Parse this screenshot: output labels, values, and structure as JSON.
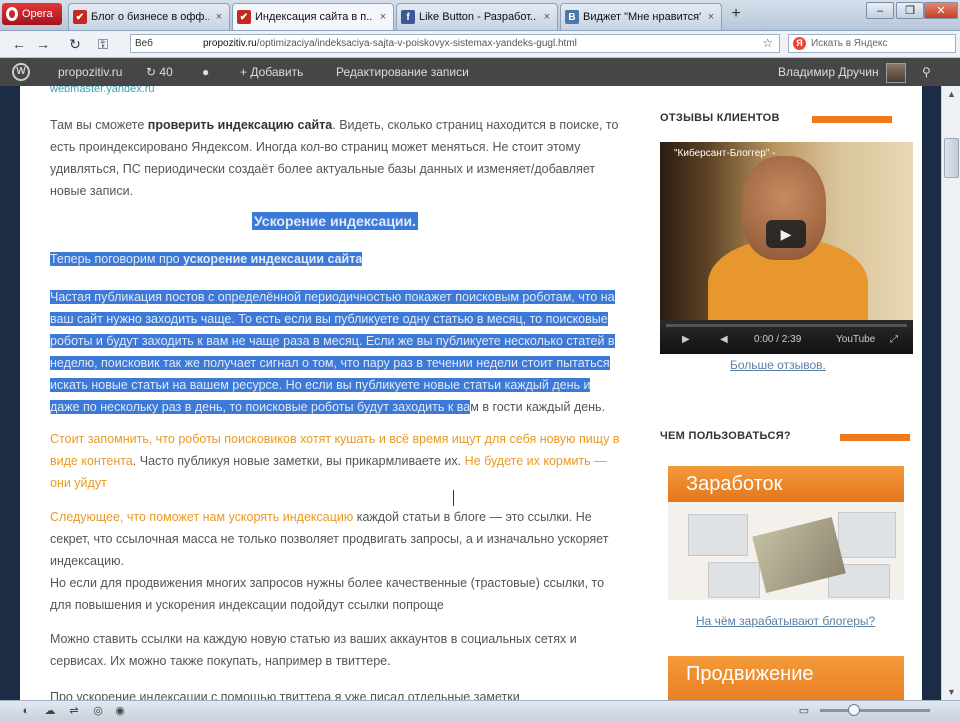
{
  "browser": {
    "app_label": "Opera",
    "tabs": [
      {
        "title": "Блог о бизнесе в офф...",
        "favicon": "blogger-icon",
        "active": false
      },
      {
        "title": "Индексация сайта в п...",
        "favicon": "blogger-icon",
        "active": true
      },
      {
        "title": "Like Button - Разработ...",
        "favicon": "facebook-icon",
        "active": false
      },
      {
        "title": "Виджет \"Мне нравится\"",
        "favicon": "vk-icon",
        "active": false
      }
    ],
    "new_tab": "+",
    "web_label": "Веб",
    "url_domain": "propozitiv.ru",
    "url_path": "/optimizaciya/indeksaciya-sajta-v-poiskovyx-sistemax-yandeks-gugl.html",
    "search_placeholder": "Искать в Яндекс"
  },
  "wpbar": {
    "site": "propozitiv.ru",
    "updates": "40",
    "add": "+ Добавить",
    "edit": "Редактирование записи",
    "user": "Владимир Дручин"
  },
  "content": {
    "top_link": "webmaster.yandex.ru",
    "p1_a": "Там вы сможете ",
    "p1_b": "проверить индексацию сайта",
    "p1_c": ". Видеть, сколько страниц находится в поиске, то есть проиндексировано Яндексом. Иногда кол-во страниц может меняться. Не стоит этому удивляться, ПС периодически создаёт более актуальные базы данных и изменяет/добавляет новые записи.",
    "heading": "Ускорение индексации.",
    "p2_a": "Теперь поговорим про ",
    "p2_b": "ускорение индексации сайта",
    "p3_sel": "Частая публикация постов с определённой периодичностью покажет поисковым роботам, что на ваш сайт нужно заходить чаще. То есть если вы публикуете одну статью в месяц, то поисковые роботы и будут заходить к вам не чаще раза в месяц. Если же вы публикуете несколько статей в неделю, поисковик так же получает сигнал о том, что пару раз в течении недели стоит пытаться искать новые статьи на вашем ресурсе. Но если вы публикуете новые статьи каждый день и даже по нескольку раз в день, то поисковые роботы будут заходить к ва",
    "p3_rest": "м в гости каждый день.",
    "p4_a": "Стоит запомнить, что роботы поисковиков хотят кушать и всё время ищут для себя новую пищу в виде контента",
    "p4_b": ". Часто публикуя новые заметки, вы прикармливаете их. ",
    "p4_c": "Не будете их кормить — они уйдут",
    "p5_a": "Следующее, что поможет нам ускорять индексацию",
    "p5_b": " каждой статьи в блоге — это ссылки. Не секрет, что ссылочная масса не только позволяет продвигать запросы, а и изначально ускоряет индексацию.",
    "p5_c": "Но если для продвижения многих запросов нужны более качественные (трастовые) ссылки, то для повышения и ускорения индексации подойдут ссылки попроще",
    "p6": "Можно ставить ссылки на каждую новую статью из ваших аккаунтов в социальных сетях и сервисах. Их можно также покупать, например в твиттере.",
    "p7": "Про ускорение индексации с помощью твиттера я уже писал отдельные заметки"
  },
  "sidebar": {
    "reviews_title": "ОТЗЫВЫ КЛИЕНТОВ",
    "video_title": "\"Киберсант-Блоггер\" -",
    "video_time": "0:00 / 2:39",
    "video_brand": "YouTube",
    "more_reviews": "Больше отзывов.",
    "tools_title": "ЧЕМ ПОЛЬЗОВАТЬСЯ?",
    "banner1": "Заработок",
    "banner1_link": "На чём зарабатывают блогеры?",
    "banner2": "Продвижение"
  },
  "colors": {
    "accent_orange": "#f07a1b",
    "selection": "#3d79d6",
    "admin_bar": "#464646"
  }
}
